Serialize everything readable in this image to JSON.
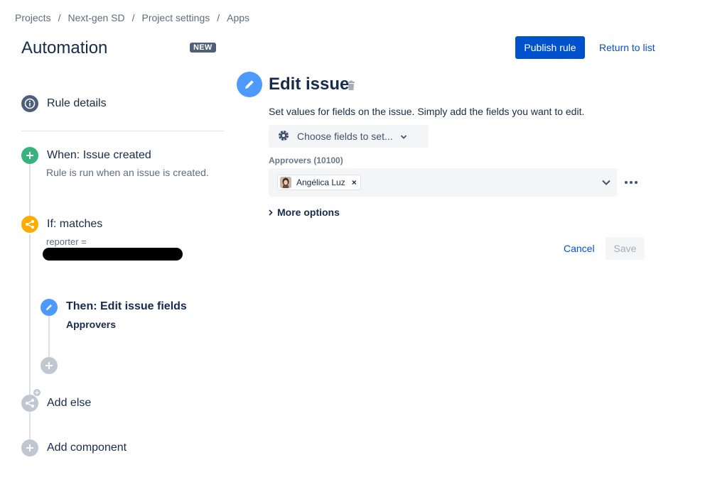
{
  "breadcrumb": {
    "items": [
      "Projects",
      "Next-gen SD",
      "Project settings",
      "Apps"
    ],
    "separator": "/"
  },
  "header": {
    "title": "Automation",
    "badge": "NEW",
    "publish_label": "Publish rule",
    "return_label": "Return to list"
  },
  "rule": {
    "details_label": "Rule details",
    "trigger": {
      "label": "When: Issue created",
      "description": "Rule is run when an issue is created."
    },
    "condition": {
      "label": "If: matches",
      "description": "reporter ="
    },
    "action": {
      "label": "Then: Edit issue fields",
      "description": "Approvers"
    },
    "add_else_label": "Add else",
    "add_component_label": "Add component"
  },
  "editor": {
    "title": "Edit issue",
    "description": "Set values for fields on the issue. Simply add the fields you want to edit.",
    "choose_fields_label": "Choose fields to set...",
    "field_label": "Approvers (10100)",
    "selected_user": "Angélica Luz",
    "remove_symbol": "×",
    "more_options_label": "More options",
    "cancel_label": "Cancel",
    "save_label": "Save"
  },
  "colors": {
    "primary": "#0052cc",
    "trigger": "#36b37e",
    "condition": "#ffab00",
    "action": "#4c9aff",
    "info": "#505f79",
    "disabled": "#c1c7d0"
  }
}
